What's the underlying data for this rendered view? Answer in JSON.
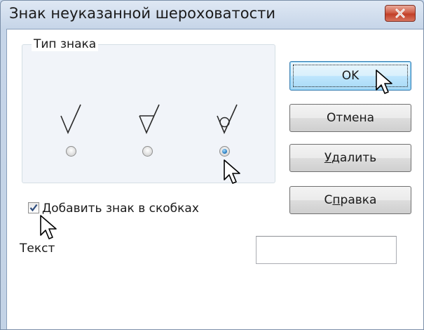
{
  "window": {
    "title": "Знак неуказанной шероховатости",
    "close_icon": "close-x-icon"
  },
  "group": {
    "legend": "Тип знака",
    "options": [
      {
        "icon": "roughness-basic-icon",
        "selected": false
      },
      {
        "icon": "roughness-removal-icon",
        "selected": false
      },
      {
        "icon": "roughness-no-removal-icon",
        "selected": true
      }
    ]
  },
  "buttons": {
    "ok": "OK",
    "cancel": "Отмена",
    "delete_access_key": "У",
    "delete_rest": "далить",
    "help_pre": "С",
    "help_access_key": "п",
    "help_rest": "равка"
  },
  "checkbox": {
    "label": "Добавить знак в скобках",
    "checked": true
  },
  "text_field": {
    "label": "Текст",
    "value": ""
  },
  "colors": {
    "title_bar": "#c6d5e8",
    "close_button": "#c23f27",
    "default_button": "#bee6fd",
    "radio_selected": "#1d73b8"
  }
}
